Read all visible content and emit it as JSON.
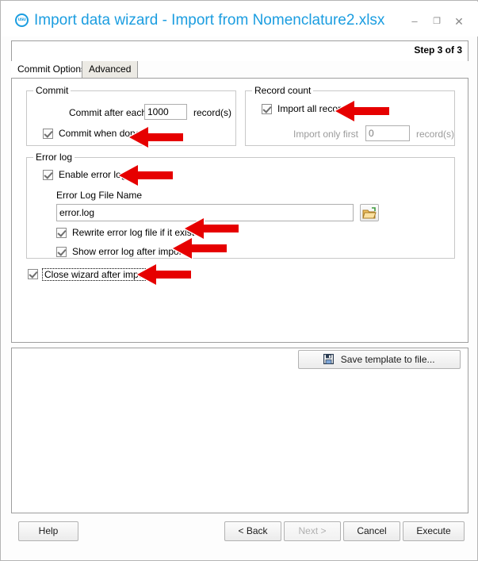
{
  "window": {
    "title": "Import data wizard - Import from Nomenclature2.xlsx",
    "icon": "usu-logo-icon",
    "minimize": "–",
    "maximize": "❐",
    "close": "✕"
  },
  "header": {
    "step_text": "Step 3 of 3"
  },
  "tabs": [
    {
      "label": "Commit Options",
      "active": true
    },
    {
      "label": "Advanced",
      "active": false
    }
  ],
  "commit_group": {
    "title": "Commit",
    "commit_after_each_label": "Commit after each",
    "commit_after_each_value": "1000",
    "records_suffix": "record(s)",
    "commit_when_done_label": "Commit when done",
    "commit_when_done_checked": true
  },
  "record_count_group": {
    "title": "Record count",
    "import_all_label": "Import all records",
    "import_all_checked": true,
    "import_only_first_label": "Import only first",
    "import_only_first_value": "0",
    "records_suffix": "record(s)"
  },
  "error_log_group": {
    "title": "Error log",
    "enable_label": "Enable error log",
    "enable_checked": true,
    "file_name_label": "Error Log File Name",
    "file_name_value": "error.log",
    "browse_icon": "open-folder-icon",
    "rewrite_label": "Rewrite error log file if it exists",
    "rewrite_checked": true,
    "show_after_import_label": "Show error log after import",
    "show_after_import_checked": true
  },
  "close_wizard": {
    "label": "Close wizard after import",
    "checked": true
  },
  "template": {
    "save_label": "Save template to file...",
    "save_icon": "floppy-save-icon"
  },
  "footer": {
    "help": "Help",
    "back": "< Back",
    "next": "Next >",
    "cancel": "Cancel",
    "execute": "Execute"
  },
  "annotations": {
    "arrow_color": "#e60000",
    "count": 6,
    "targets": [
      "commit-when-done",
      "import-all-records",
      "enable-error-log",
      "rewrite-error-log",
      "show-error-log",
      "close-wizard-after-import"
    ]
  },
  "colors": {
    "title_blue": "#1b9de0",
    "arrow_red": "#e60000",
    "border_grey": "#9e9e9e"
  }
}
